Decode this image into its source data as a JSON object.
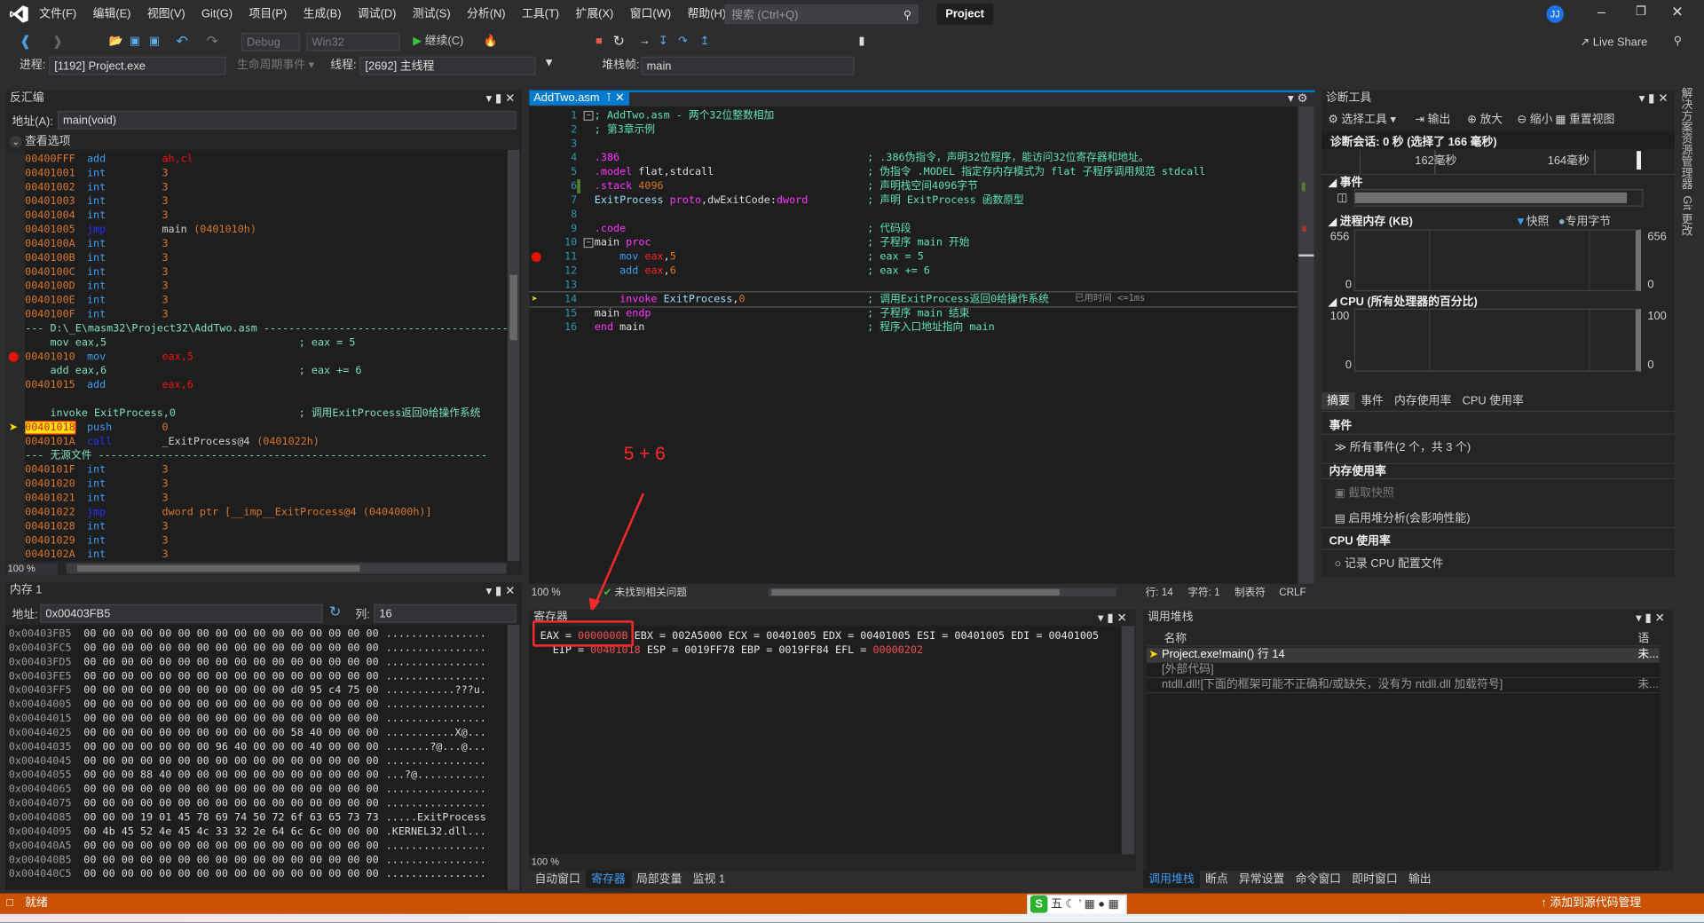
{
  "menu": {
    "items": [
      "文件(F)",
      "编辑(E)",
      "视图(V)",
      "Git(G)",
      "项目(P)",
      "生成(B)",
      "调试(D)",
      "测试(S)",
      "分析(N)",
      "工具(T)",
      "扩展(X)",
      "窗口(W)",
      "帮助(H)"
    ],
    "search_placeholder": "搜索 (Ctrl+Q)",
    "project": "Project",
    "avatar": "JJ"
  },
  "toolbar": {
    "config": "Debug",
    "platform": "Win32",
    "continue": "继续(C)",
    "live_share": "Live Share"
  },
  "debugbar": {
    "process_label": "进程:",
    "process": "[1192] Project.exe",
    "lifecycle": "生命周期事件",
    "thread_label": "线程:",
    "thread": "[2692] 主线程",
    "frame_label": "堆栈帧:",
    "frame": "main"
  },
  "disasm": {
    "title": "反汇编",
    "address_label": "地址(A):",
    "address": "main(void)",
    "options": "查看选项",
    "zoom": "100 %",
    "rows": [
      {
        "a": "00400FFF",
        "o": "add",
        "g": "ah,cl",
        "t": "reg"
      },
      {
        "a": "00401001",
        "o": "int",
        "g": "3"
      },
      {
        "a": "00401002",
        "o": "int",
        "g": "3"
      },
      {
        "a": "00401003",
        "o": "int",
        "g": "3"
      },
      {
        "a": "00401004",
        "o": "int",
        "g": "3"
      },
      {
        "a": "00401005",
        "o": "jmp",
        "g": "main",
        "g2": "(0401010h)",
        "j": true
      },
      {
        "a": "0040100A",
        "o": "int",
        "g": "3"
      },
      {
        "a": "0040100B",
        "o": "int",
        "g": "3"
      },
      {
        "a": "0040100C",
        "o": "int",
        "g": "3"
      },
      {
        "a": "0040100D",
        "o": "int",
        "g": "3"
      },
      {
        "a": "0040100E",
        "o": "int",
        "g": "3"
      },
      {
        "a": "0040100F",
        "o": "int",
        "g": "3"
      },
      {
        "s": "--- D:\\_E\\masm32\\Project32\\AddTwo.asm ---------------------------------------"
      },
      {
        "s": "    mov eax,5",
        "c": "; eax = 5"
      },
      {
        "a": "00401010",
        "o": "mov",
        "g": "eax,5",
        "t": "reg",
        "bp": true
      },
      {
        "s": "    add eax,6",
        "c": "; eax += 6"
      },
      {
        "a": "00401015",
        "o": "add",
        "g": "eax,6",
        "t": "reg"
      },
      {
        "s": ""
      },
      {
        "s": "    invoke ExitProcess,0",
        "c": "; 调用ExitProcess返回0给操作系统"
      },
      {
        "a": "00401018",
        "o": "push",
        "g": "0",
        "cur": true
      },
      {
        "a": "0040101A",
        "o": "call",
        "g": "_ExitProcess@4",
        "g2": "(0401022h)",
        "j": true
      },
      {
        "s": "--- 无源文件 --------------------------------------------------------------"
      },
      {
        "a": "0040101F",
        "o": "int",
        "g": "3"
      },
      {
        "a": "00401020",
        "o": "int",
        "g": "3"
      },
      {
        "a": "00401021",
        "o": "int",
        "g": "3"
      },
      {
        "a": "00401022",
        "o": "jmp",
        "g": "dword ptr [__imp__ExitProcess@4 (0404000h)]",
        "j": true
      },
      {
        "a": "00401028",
        "o": "int",
        "g": "3"
      },
      {
        "a": "00401029",
        "o": "int",
        "g": "3"
      },
      {
        "a": "0040102A",
        "o": "int",
        "g": "3"
      }
    ]
  },
  "memory": {
    "title": "内存 1",
    "address_label": "地址:",
    "address": "0x00403FB5",
    "columns_label": "列:",
    "columns": "16",
    "rows": [
      {
        "a": "0x00403FB5",
        "h": "00 00 00 00 00 00 00 00 00 00 00 00 00 00 00 00",
        "t": "................"
      },
      {
        "a": "0x00403FC5",
        "h": "00 00 00 00 00 00 00 00 00 00 00 00 00 00 00 00",
        "t": "................"
      },
      {
        "a": "0x00403FD5",
        "h": "00 00 00 00 00 00 00 00 00 00 00 00 00 00 00 00",
        "t": "................"
      },
      {
        "a": "0x00403FE5",
        "h": "00 00 00 00 00 00 00 00 00 00 00 00 00 00 00 00",
        "t": "................"
      },
      {
        "a": "0x00403FF5",
        "h": "00 00 00 00 00 00 00 00 00 00 00 d0 95 c4 75 00",
        "t": "...........???u."
      },
      {
        "a": "0x00404005",
        "h": "00 00 00 00 00 00 00 00 00 00 00 00 00 00 00 00",
        "t": "................"
      },
      {
        "a": "0x00404015",
        "h": "00 00 00 00 00 00 00 00 00 00 00 00 00 00 00 00",
        "t": "................"
      },
      {
        "a": "0x00404025",
        "h": "00 00 00 00 00 00 00 00 00 00 00 58 40 00 00 00",
        "t": "...........X@..."
      },
      {
        "a": "0x00404035",
        "h": "00 00 00 00 00 00 00 96 40 00 00 00 40 00 00 00",
        "t": ".......?@...@..."
      },
      {
        "a": "0x00404045",
        "h": "00 00 00 00 00 00 00 00 00 00 00 00 00 00 00 00",
        "t": "................"
      },
      {
        "a": "0x00404055",
        "h": "00 00 00 88 40 00 00 00 00 00 00 00 00 00 00 00",
        "t": "...?@..........."
      },
      {
        "a": "0x00404065",
        "h": "00 00 00 00 00 00 00 00 00 00 00 00 00 00 00 00",
        "t": "................"
      },
      {
        "a": "0x00404075",
        "h": "00 00 00 00 00 00 00 00 00 00 00 00 00 00 00 00",
        "t": "................"
      },
      {
        "a": "0x00404085",
        "h": "00 00 00 19 01 45 78 69 74 50 72 6f 63 65 73 73",
        "t": ".....ExitProcess"
      },
      {
        "a": "0x00404095",
        "h": "00 4b 45 52 4e 45 4c 33 32 2e 64 6c 6c 00 00 00",
        "t": ".KERNEL32.dll..."
      },
      {
        "a": "0x004040A5",
        "h": "00 00 00 00 00 00 00 00 00 00 00 00 00 00 00 00",
        "t": "................"
      },
      {
        "a": "0x004040B5",
        "h": "00 00 00 00 00 00 00 00 00 00 00 00 00 00 00 00",
        "t": "................"
      },
      {
        "a": "0x004040C5",
        "h": "00 00 00 00 00 00 00 00 00 00 00 00 00 00 00 00",
        "t": "................"
      }
    ]
  },
  "editor": {
    "tab": "AddTwo.asm",
    "zoom": "100 %",
    "issues": "未找到相关问题",
    "line": "行: 14",
    "char": "字符: 1",
    "indent": "制表符",
    "eol": "CRLF",
    "elapsed": "已用时间 <=1ms",
    "lines": [
      {
        "c": [
          [
            ";",
            "k-cm"
          ],
          [
            " AddTwo.asm - 两个32位整数相加",
            "k-cm"
          ]
        ]
      },
      {
        "c": [
          [
            "; 第3章示例",
            "k-cm"
          ]
        ]
      },
      {
        "c": []
      },
      {
        "c": [
          [
            ".386",
            "k-dir"
          ]
        ],
        "m": "; .386伪指令，声明32位程序，能访问32位寄存器和地址。"
      },
      {
        "c": [
          [
            ".model",
            "k-dir"
          ],
          [
            " flat,stdcall",
            "k-txt"
          ]
        ],
        "m": "; 伪指令 .MODEL 指定存内存模式为 flat 子程序调用规范 stdcall"
      },
      {
        "c": [
          [
            ".stack",
            "k-dir"
          ],
          [
            " 4096",
            "k-num"
          ]
        ],
        "m": "; 声明栈空间4096字节"
      },
      {
        "c": [
          [
            "ExitProcess",
            "k-id"
          ],
          [
            " proto",
            "k-dir"
          ],
          [
            ",dwExitCode:",
            "k-txt"
          ],
          [
            "dword",
            "k-dir"
          ]
        ],
        "m": "; 声明 ExitProcess 函数原型"
      },
      {
        "c": []
      },
      {
        "c": [
          [
            ".code",
            "k-dir"
          ]
        ],
        "m": "; 代码段"
      },
      {
        "c": [
          [
            "main",
            "k-txt"
          ],
          [
            " proc",
            "k-dir"
          ]
        ],
        "m": "; 子程序 main 开始"
      },
      {
        "c": [
          [
            "    mov",
            "k-ins"
          ],
          [
            " eax",
            "k-reg"
          ],
          [
            ",",
            "k-txt"
          ],
          [
            "5",
            "k-num"
          ]
        ],
        "m": "; eax = 5"
      },
      {
        "c": [
          [
            "    add",
            "k-ins"
          ],
          [
            " eax",
            "k-reg"
          ],
          [
            ",",
            "k-txt"
          ],
          [
            "6",
            "k-num"
          ]
        ],
        "m": "; eax += 6"
      },
      {
        "c": []
      },
      {
        "c": [
          [
            "    invoke",
            "k-dir"
          ],
          [
            " ExitProcess",
            "k-id"
          ],
          [
            ",",
            "k-txt"
          ],
          [
            "0",
            "k-num"
          ]
        ],
        "m": "; 调用ExitProcess返回0给操作系统"
      },
      {
        "c": [
          [
            "main",
            "k-txt"
          ],
          [
            " endp",
            "k-dir"
          ]
        ],
        "m": "; 子程序 main 结束"
      },
      {
        "c": [
          [
            "end",
            "k-dir"
          ],
          [
            " main",
            "k-txt"
          ]
        ],
        "m": "; 程序入口地址指向 main"
      }
    ]
  },
  "annotation": {
    "text": "5 + 6",
    "color": "#ff2a2a"
  },
  "registers": {
    "title": "寄存器",
    "zoom": "100 %",
    "line1": [
      [
        "EAX = ",
        ""
      ],
      [
        "0000000B",
        "chg"
      ],
      [
        " EBX = 002A5000 ECX = 00401005 EDX = 00401005 ESI = 00401005 EDI = 00401005",
        ""
      ]
    ],
    "line2": [
      [
        "  EIP = ",
        ""
      ],
      [
        "00401018",
        "chg"
      ],
      [
        " ESP = 0019FF78 EBP = 0019FF84 EFL = ",
        ""
      ],
      [
        "00000202",
        "chg"
      ]
    ]
  },
  "bottom_tabs_left": [
    "自动窗口",
    "寄存器",
    "局部变量",
    "监视 1"
  ],
  "callstack": {
    "title": "调用堆栈",
    "col_name": "名称",
    "col_lang": "语言",
    "rows": [
      {
        "name": "Project.exe!main() 行 14",
        "lang": "未...",
        "cur": true
      },
      {
        "name": "[外部代码]",
        "lang": ""
      },
      {
        "name": "ntdll.dll![下面的框架可能不正确和/或缺失，没有为 ntdll.dll 加载符号]",
        "lang": "未..."
      }
    ]
  },
  "bottom_tabs_right": [
    "调用堆栈",
    "断点",
    "异常设置",
    "命令窗口",
    "即时窗口",
    "输出"
  ],
  "diag": {
    "title": "诊断工具",
    "select_tools": "选择工具",
    "export": "输出",
    "zoom_in": "放大",
    "zoom_out": "缩小",
    "reset": "重置视图",
    "session": "诊断会话: 0 秒 (选择了 166 毫秒)",
    "t1": "162毫秒",
    "t2": "164毫秒",
    "events": "事件",
    "memory": "进程内存 (KB)",
    "snapshot": "快照",
    "private_bytes": "专用字节",
    "mem_max": "656",
    "mem_min": "0",
    "cpu": "CPU (所有处理器的百分比)",
    "cpu_max": "100",
    "cpu_min": "0",
    "tabs": [
      "摘要",
      "事件",
      "内存使用率",
      "CPU 使用率"
    ],
    "s_events": "事件",
    "all_events": "所有事件(2 个，共 3 个)",
    "s_memory": "内存使用率",
    "take_snapshot": "截取快照",
    "heap": "启用堆分析(会影响性能)",
    "s_cpu": "CPU 使用率",
    "record_cpu": "记录 CPU 配置文件"
  },
  "side": {
    "solution_explorer": "解决方案资源管理器",
    "git": "Git 更改"
  },
  "status": {
    "ready": "就绪",
    "source_control": "添加到源代码管理",
    "color": "#ca5100"
  },
  "ime": {
    "label": "五"
  }
}
